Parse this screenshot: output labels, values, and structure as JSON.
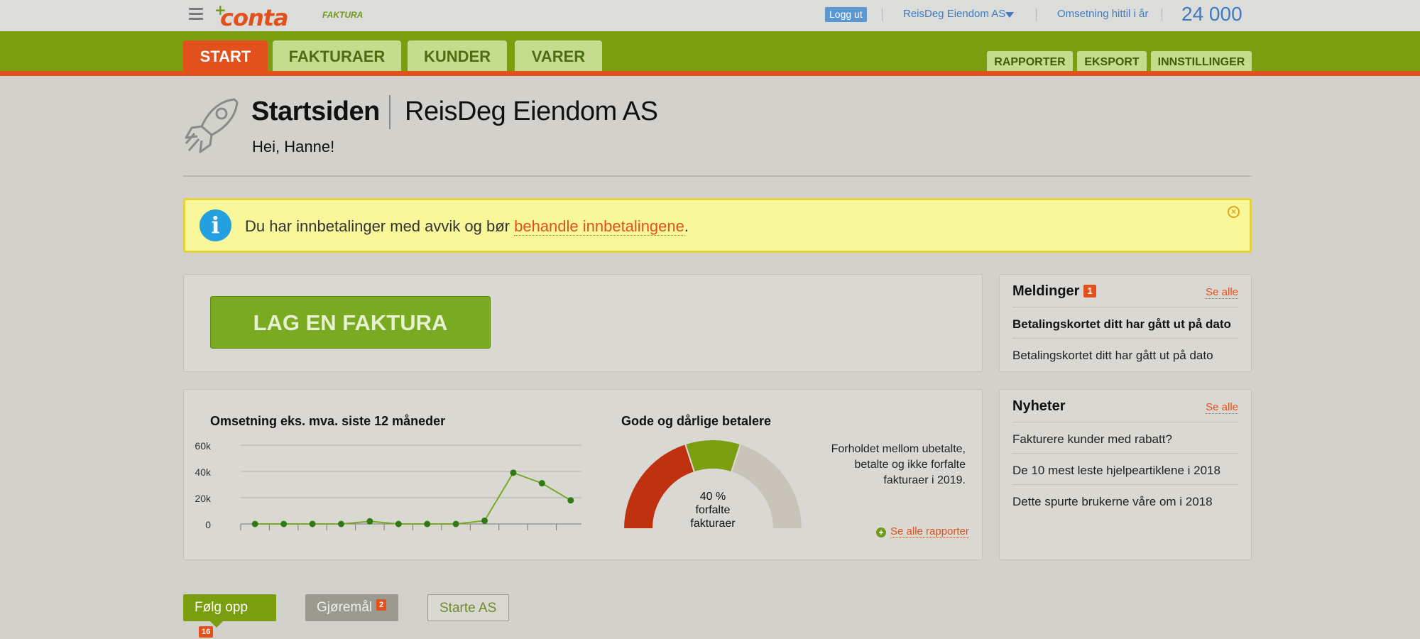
{
  "topbar": {
    "logo_word": "conta",
    "logo_sub": "FAKTURA",
    "logout_label": "Logg ut",
    "company": "ReisDeg Eiendom AS",
    "turnover_label": "Omsetning hittil i år",
    "turnover_value": "24 000"
  },
  "nav": {
    "tabs": [
      "START",
      "FAKTURAER",
      "KUNDER",
      "VARER"
    ],
    "active_tab": "START",
    "subtabs": [
      "RAPPORTER",
      "EKSPORT",
      "INNSTILLINGER"
    ]
  },
  "header": {
    "title": "Startsiden",
    "company": "ReisDeg Eiendom AS",
    "greeting": "Hei, Hanne!"
  },
  "notice": {
    "text_before": "Du har innbetalinger med avvik og bør ",
    "link": "behandle innbetalingene",
    "text_after": "."
  },
  "create_invoice_label": "LAG EN FAKTURA",
  "messages": {
    "title": "Meldinger",
    "badge": "1",
    "see_all": "Se alle",
    "items": [
      {
        "text": "Betalingskortet ditt har gått ut på dato",
        "unread": true
      },
      {
        "text": "Betalingskortet ditt har gått ut på dato",
        "unread": false
      }
    ]
  },
  "news": {
    "title": "Nyheter",
    "see_all": "Se alle",
    "items": [
      "Fakturere kunder med rabatt?",
      "De 10 mest leste hjelpeartiklene i 2018",
      "Dette spurte brukerne våre om i 2018"
    ]
  },
  "chart_data": [
    {
      "type": "line",
      "title": "Omsetning eks. mva. siste 12 måneder",
      "yticks": [
        "60k",
        "40k",
        "20k",
        "0"
      ],
      "ylim": [
        0,
        60000
      ],
      "x": [
        1,
        2,
        3,
        4,
        5,
        6,
        7,
        8,
        9,
        10,
        11,
        12
      ],
      "values": [
        0,
        0,
        0,
        0,
        2000,
        0,
        0,
        0,
        2500,
        39000,
        31000,
        18000
      ],
      "grid": true,
      "color": "#7aaa22"
    },
    {
      "type": "pie",
      "title": "Gode og dårlige betalere",
      "slices": [
        {
          "value": 40,
          "color": "#c0320f"
        },
        {
          "value": 20,
          "color": "#7a9e0f"
        },
        {
          "value": 40,
          "color": "#c8c4ba"
        }
      ],
      "center_value": "40 %",
      "center_label_1": "forfalte",
      "center_label_2": "fakturaer",
      "description": "Forholdet mellom ubetalte, betalte og ikke forfalte fakturaer i 2019.",
      "link": "Se alle rapporter"
    }
  ],
  "bottom_tabs": [
    {
      "label": "Følg opp",
      "badge": "16"
    },
    {
      "label": "Gjøremål",
      "badge": "2"
    },
    {
      "label": "Starte AS",
      "badge": ""
    }
  ]
}
